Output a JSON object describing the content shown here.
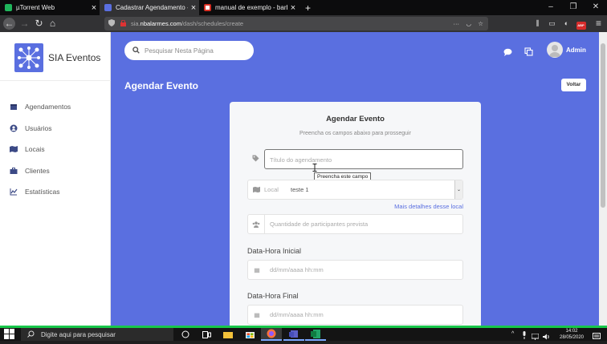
{
  "browser": {
    "tabs": [
      {
        "label": "µTorrent Web",
        "active": false
      },
      {
        "label": "Cadastrar Agendamento - SIA",
        "active": true
      },
      {
        "label": "manual de exemplo - barbosa",
        "active": false
      }
    ],
    "new_tab_label": "+",
    "url_prefix": "sia.",
    "url_host": "nbalarmes.com",
    "url_path": "/dash/schedules/create",
    "ext_badge": "ABP"
  },
  "sidebar": {
    "brand": "SIA Eventos",
    "items": [
      {
        "label": "Agendamentos",
        "icon": "calendar-icon"
      },
      {
        "label": "Usuários",
        "icon": "user-icon"
      },
      {
        "label": "Locais",
        "icon": "map-icon"
      },
      {
        "label": "Clientes",
        "icon": "briefcase-icon"
      },
      {
        "label": "Estatísticas",
        "icon": "chart-icon"
      }
    ]
  },
  "header": {
    "search_placeholder": "Pesquisar Nesta Página",
    "user_name": "Admin",
    "page_title": "Agendar Evento",
    "back_button": "Voltar"
  },
  "form": {
    "title": "Agendar Evento",
    "subtitle": "Preencha os campos abaixo para prosseguir",
    "title_placeholder": "Título do agendamento",
    "tooltip": "Preencha este campo",
    "location_label": "Local",
    "location_value": "teste 1",
    "details_link": "Mais detalhes desse local",
    "participants_placeholder": "Quantidade de participantes prevista",
    "start_label": "Data-Hora Inicial",
    "start_placeholder": "dd/mm/aaaa hh:mm",
    "end_label": "Data-Hora Final",
    "end_placeholder": "dd/mm/aaaa hh:mm"
  },
  "taskbar": {
    "search_placeholder": "Digite aqui para pesquisar",
    "time": "14:02",
    "date": "28/05/2020"
  },
  "colors": {
    "primary": "#5a6fe0",
    "sidebar_bg": "#ffffff",
    "taskbar_accent": "#18c74a"
  }
}
